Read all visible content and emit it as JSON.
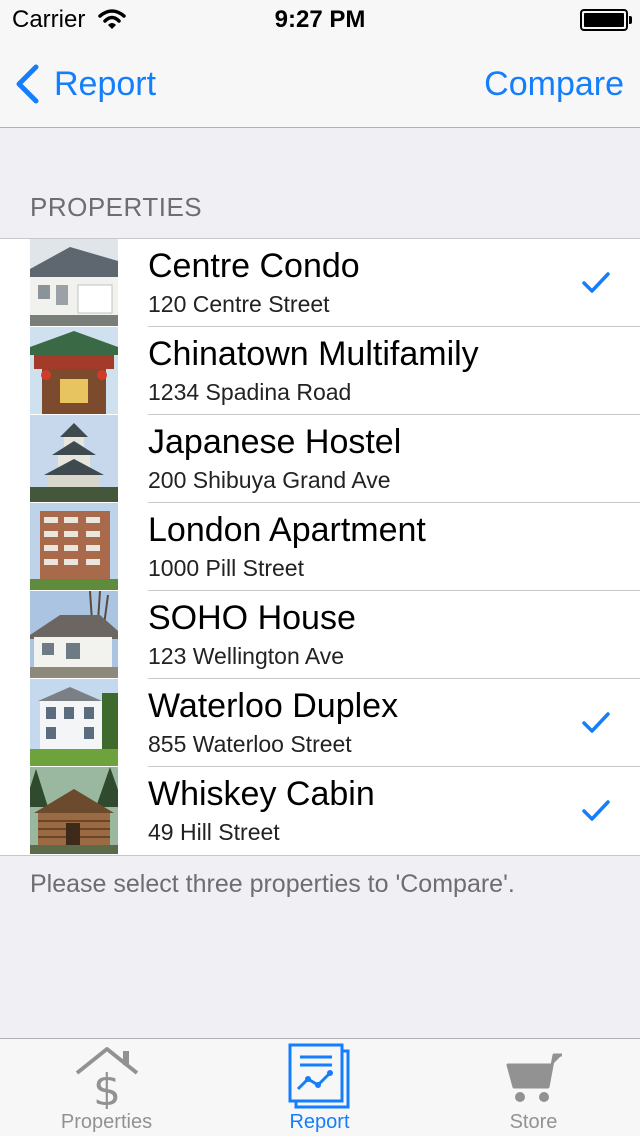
{
  "status_bar": {
    "carrier": "Carrier",
    "time": "9:27 PM"
  },
  "nav": {
    "back_label": "Report",
    "right_button": "Compare"
  },
  "section_header": "PROPERTIES",
  "properties": [
    {
      "name": "Centre Condo",
      "address": "120 Centre Street",
      "selected": true
    },
    {
      "name": "Chinatown Multifamily",
      "address": "1234 Spadina Road",
      "selected": false
    },
    {
      "name": "Japanese Hostel",
      "address": "200 Shibuya Grand Ave",
      "selected": false
    },
    {
      "name": "London Apartment",
      "address": "1000 Pill Street",
      "selected": false
    },
    {
      "name": "SOHO House",
      "address": "123 Wellington Ave",
      "selected": false
    },
    {
      "name": "Waterloo Duplex",
      "address": "855 Waterloo Street",
      "selected": true
    },
    {
      "name": "Whiskey Cabin",
      "address": "49 Hill Street",
      "selected": true
    }
  ],
  "footer_note": "Please select three properties to 'Compare'.",
  "tabs": [
    {
      "label": "Properties",
      "icon": "house-dollar-icon",
      "active": false
    },
    {
      "label": "Report",
      "icon": "report-chart-icon",
      "active": true
    },
    {
      "label": "Store",
      "icon": "cart-icon",
      "active": false
    }
  ],
  "colors": {
    "accent": "#157efb",
    "inactive": "#929292",
    "background": "#efeff4"
  }
}
